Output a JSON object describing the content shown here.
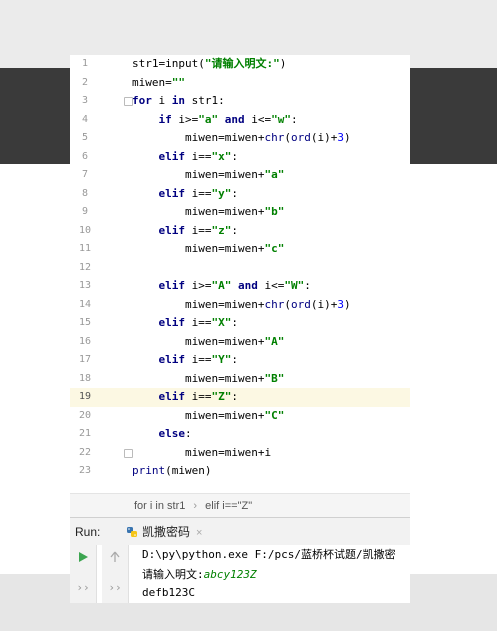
{
  "editor": {
    "lines": [
      {
        "n": "1",
        "tokens": [
          [
            "t",
            "str1=input("
          ],
          [
            "s",
            "\"请输入明文:\""
          ],
          [
            "t",
            ")"
          ]
        ]
      },
      {
        "n": "2",
        "tokens": [
          [
            "t",
            "miwen="
          ],
          [
            "s",
            "\"\""
          ]
        ]
      },
      {
        "n": "3",
        "tokens": [
          [
            "k",
            "for"
          ],
          [
            "t",
            " i "
          ],
          [
            "k",
            "in"
          ],
          [
            "t",
            " str1:"
          ]
        ]
      },
      {
        "n": "4",
        "tokens": [
          [
            "t",
            "    "
          ],
          [
            "k",
            "if"
          ],
          [
            "t",
            " i>="
          ],
          [
            "s",
            "\"a\""
          ],
          [
            "t",
            " "
          ],
          [
            "k",
            "and"
          ],
          [
            "t",
            " i<="
          ],
          [
            "s",
            "\"w\""
          ],
          [
            "t",
            ":"
          ]
        ]
      },
      {
        "n": "5",
        "tokens": [
          [
            "t",
            "        miwen=miwen+"
          ],
          [
            "b",
            "chr"
          ],
          [
            "t",
            "("
          ],
          [
            "b",
            "ord"
          ],
          [
            "t",
            "(i)+"
          ],
          [
            "n",
            "3"
          ],
          [
            "t",
            ")"
          ]
        ]
      },
      {
        "n": "6",
        "tokens": [
          [
            "t",
            "    "
          ],
          [
            "k",
            "elif"
          ],
          [
            "t",
            " i=="
          ],
          [
            "s",
            "\"x\""
          ],
          [
            "t",
            ":"
          ]
        ]
      },
      {
        "n": "7",
        "tokens": [
          [
            "t",
            "        miwen=miwen+"
          ],
          [
            "s",
            "\"a\""
          ]
        ]
      },
      {
        "n": "8",
        "tokens": [
          [
            "t",
            "    "
          ],
          [
            "k",
            "elif"
          ],
          [
            "t",
            " i=="
          ],
          [
            "s",
            "\"y\""
          ],
          [
            "t",
            ":"
          ]
        ]
      },
      {
        "n": "9",
        "tokens": [
          [
            "t",
            "        miwen=miwen+"
          ],
          [
            "s",
            "\"b\""
          ]
        ]
      },
      {
        "n": "10",
        "tokens": [
          [
            "t",
            "    "
          ],
          [
            "k",
            "elif"
          ],
          [
            "t",
            " i=="
          ],
          [
            "s",
            "\"z\""
          ],
          [
            "t",
            ":"
          ]
        ]
      },
      {
        "n": "11",
        "tokens": [
          [
            "t",
            "        miwen=miwen+"
          ],
          [
            "s",
            "\"c\""
          ]
        ]
      },
      {
        "n": "12",
        "tokens": []
      },
      {
        "n": "13",
        "tokens": [
          [
            "t",
            "    "
          ],
          [
            "k",
            "elif"
          ],
          [
            "t",
            " i>="
          ],
          [
            "s",
            "\"A\""
          ],
          [
            "t",
            " "
          ],
          [
            "k",
            "and"
          ],
          [
            "t",
            " i<="
          ],
          [
            "s",
            "\"W\""
          ],
          [
            "t",
            ":"
          ]
        ]
      },
      {
        "n": "14",
        "tokens": [
          [
            "t",
            "        miwen=miwen+"
          ],
          [
            "b",
            "chr"
          ],
          [
            "t",
            "("
          ],
          [
            "b",
            "ord"
          ],
          [
            "t",
            "(i)+"
          ],
          [
            "n",
            "3"
          ],
          [
            "t",
            ")"
          ]
        ]
      },
      {
        "n": "15",
        "tokens": [
          [
            "t",
            "    "
          ],
          [
            "k",
            "elif"
          ],
          [
            "t",
            " i=="
          ],
          [
            "s",
            "\"X\""
          ],
          [
            "t",
            ":"
          ]
        ]
      },
      {
        "n": "16",
        "tokens": [
          [
            "t",
            "        miwen=miwen+"
          ],
          [
            "s",
            "\"A\""
          ]
        ]
      },
      {
        "n": "17",
        "tokens": [
          [
            "t",
            "    "
          ],
          [
            "k",
            "elif"
          ],
          [
            "t",
            " i=="
          ],
          [
            "s",
            "\"Y\""
          ],
          [
            "t",
            ":"
          ]
        ]
      },
      {
        "n": "18",
        "tokens": [
          [
            "t",
            "        miwen=miwen+"
          ],
          [
            "s",
            "\"B\""
          ]
        ]
      },
      {
        "n": "19",
        "tokens": [
          [
            "t",
            "    "
          ],
          [
            "k",
            "elif"
          ],
          [
            "t",
            " i=="
          ],
          [
            "s",
            "\"Z\""
          ],
          [
            "t",
            ":"
          ]
        ],
        "current": true
      },
      {
        "n": "20",
        "tokens": [
          [
            "t",
            "        miwen=miwen+"
          ],
          [
            "s",
            "\"C\""
          ]
        ]
      },
      {
        "n": "21",
        "tokens": [
          [
            "t",
            "    "
          ],
          [
            "k",
            "else"
          ],
          [
            "t",
            ":"
          ]
        ]
      },
      {
        "n": "22",
        "tokens": [
          [
            "t",
            "        miwen=miwen+i"
          ]
        ]
      },
      {
        "n": "23",
        "tokens": [
          [
            "b",
            "print"
          ],
          [
            "t",
            "(miwen)"
          ]
        ]
      }
    ]
  },
  "breadcrumb": {
    "part1": "for i in str1",
    "separator": "›",
    "part2": "elif i==\"Z\""
  },
  "run_panel": {
    "label": "Run:",
    "tab_label": "凯撒密码",
    "tab_close": "×",
    "output": {
      "command": "D:\\py\\python.exe F:/pcs/蓝桥杯试题/凯撒密",
      "prompt": "请输入明文:",
      "input_value": "abcy123Z",
      "result": "defb123C"
    },
    "icons": {
      "run": "run-icon",
      "up": "up-arrow-icon",
      "more_left": "double-chevron-icon",
      "more_right": "double-chevron-icon"
    }
  },
  "colors": {
    "keyword": "#000080",
    "string": "#008000",
    "number": "#0000ff",
    "current_line": "#fcf8e3",
    "dark_band": "#3a3a3a",
    "run_green": "#3ca550"
  }
}
